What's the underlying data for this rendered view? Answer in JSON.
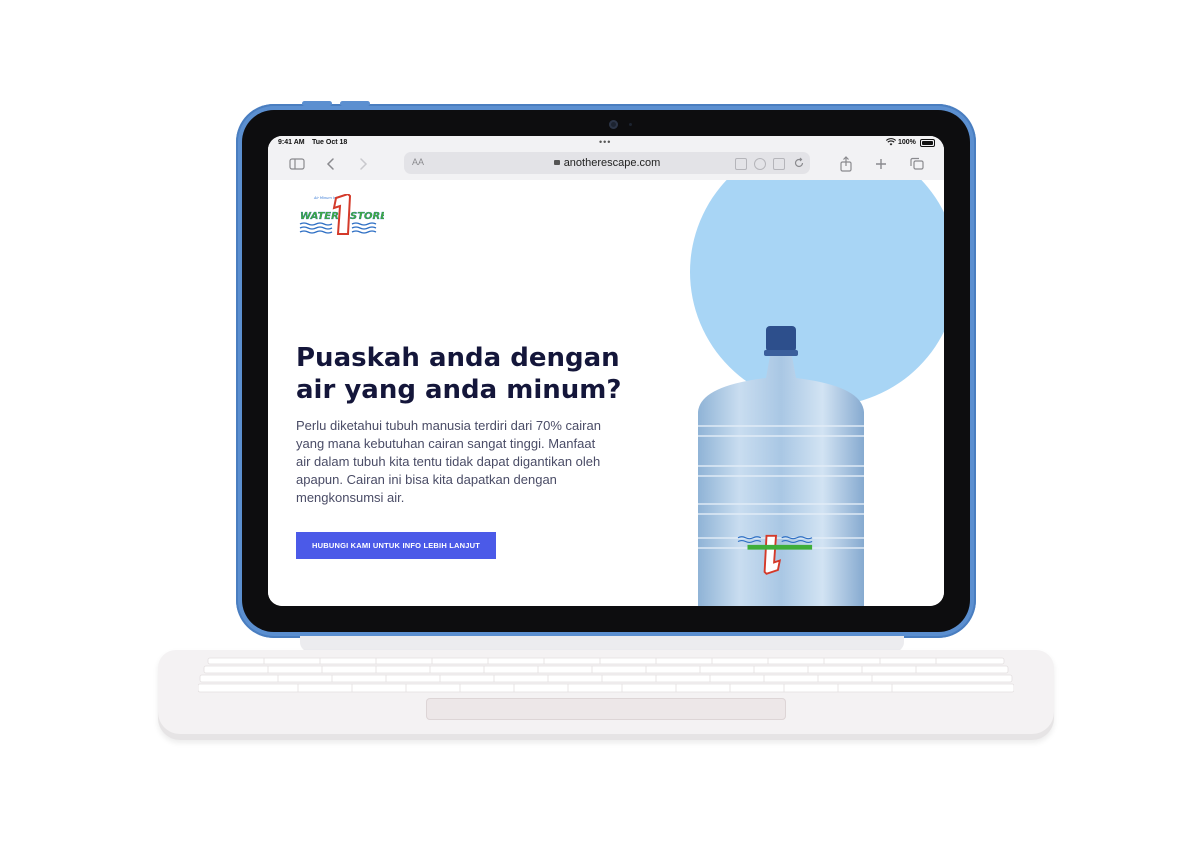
{
  "status_bar": {
    "time": "9:41 AM",
    "date": "Tue Oct 18",
    "battery": "100%"
  },
  "browser": {
    "text_size_label": "AA",
    "url": "anotherescape.com",
    "icons": [
      "sidebar-icon",
      "back-icon",
      "forward-icon",
      "lock-icon",
      "share-icon",
      "new-tab-icon",
      "tabs-icon"
    ]
  },
  "site": {
    "logo_text_1": "WATER",
    "logo_text_2": "STORE",
    "logo_numeral": "1",
    "logo_tagline": "Air Minum Isi Ulang",
    "headline": "Puaskah anda dengan air yang anda minum?",
    "body": "Perlu diketahui tubuh manusia terdiri dari 70% cairan yang mana kebutuhan cairan sangat tinggi. Manfaat air dalam tubuh kita tentu tidak dapat digantikan oleh apapun. Cairan ini bisa kita dapatkan dengan mengkonsumsi air.",
    "cta_label": "HUBUNGI KAMI UNTUK INFO LEBIH LANJUT"
  },
  "colors": {
    "accent": "#4b5ae8",
    "circle": "#a8d5f5",
    "headline": "#14163a",
    "device": "#5b8fd0"
  }
}
